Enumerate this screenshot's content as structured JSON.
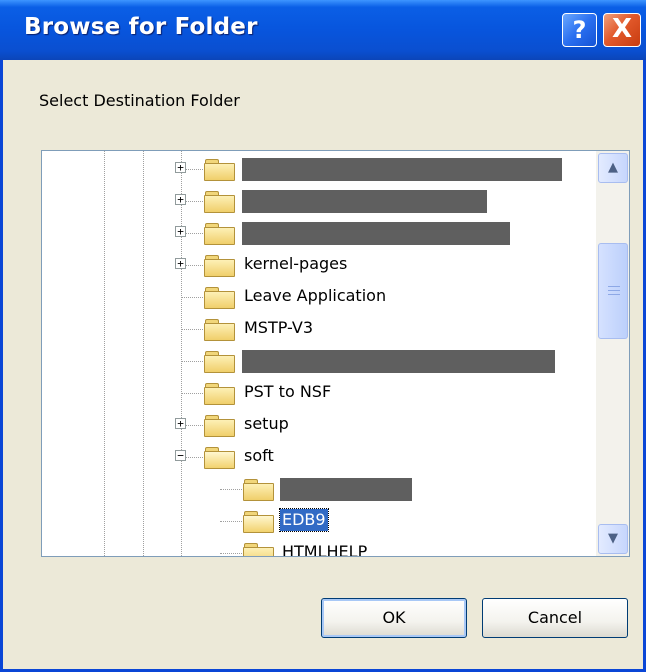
{
  "dialog": {
    "title": "Browse for Folder",
    "help_label": "?",
    "close_label": "X",
    "prompt": "Select Destination Folder"
  },
  "tree": {
    "items": [
      {
        "label": "",
        "redacted": true,
        "expander": "+",
        "open": false,
        "selected": false
      },
      {
        "label": "",
        "redacted": true,
        "expander": "+",
        "open": false,
        "selected": false
      },
      {
        "label": "",
        "redacted": true,
        "expander": "+",
        "open": false,
        "selected": false
      },
      {
        "label": "kernel-pages",
        "redacted": false,
        "expander": "+",
        "open": false,
        "selected": false
      },
      {
        "label": "Leave Application",
        "redacted": false,
        "expander": "",
        "open": false,
        "selected": false
      },
      {
        "label": "MSTP-V3",
        "redacted": false,
        "expander": "",
        "open": false,
        "selected": false
      },
      {
        "label": "",
        "redacted": true,
        "expander": "",
        "open": false,
        "selected": false
      },
      {
        "label": "PST to NSF",
        "redacted": false,
        "expander": "",
        "open": false,
        "selected": false
      },
      {
        "label": "setup",
        "redacted": false,
        "expander": "+",
        "open": false,
        "selected": false
      },
      {
        "label": "soft",
        "redacted": false,
        "expander": "−",
        "open": true,
        "selected": false
      },
      {
        "label": "",
        "redacted": true,
        "expander": "",
        "open": false,
        "selected": false
      },
      {
        "label": "EDB9",
        "redacted": false,
        "expander": "",
        "open": true,
        "selected": true
      },
      {
        "label": "HTMLHELP",
        "redacted": false,
        "expander": "",
        "open": false,
        "selected": false
      }
    ]
  },
  "scrollbar": {
    "up_icon": "▲",
    "down_icon": "▼"
  },
  "buttons": {
    "ok": "OK",
    "cancel": "Cancel"
  },
  "colors": {
    "titlebar": "#0855dd",
    "selection": "#316ac5",
    "dialog_bg": "#ece9d8"
  }
}
